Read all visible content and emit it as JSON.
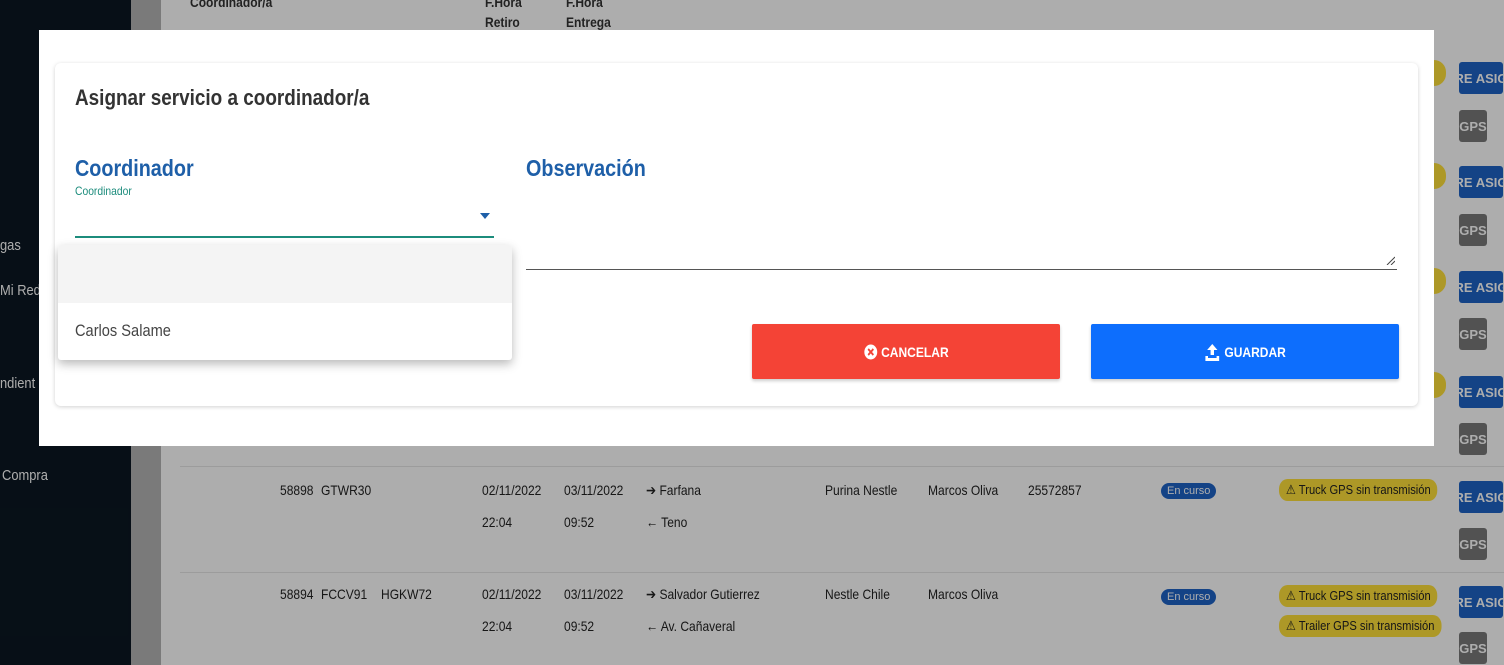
{
  "sidebar": {
    "items": [
      {
        "label": "gas"
      },
      {
        "label": "Mi Red"
      },
      {
        "label": "ndient"
      },
      {
        "label": "Compra"
      }
    ]
  },
  "table": {
    "headers": {
      "coordinador": "Coordinador/a",
      "retiro_1": "F.Hora",
      "retiro_2": "Retiro",
      "entrega_1": "F.Hora",
      "entrega_2": "Entrega"
    },
    "rows": [
      {
        "id": "58898",
        "tracto": "GTWR30",
        "rampla": "",
        "retiro_fecha": "02/11/2022",
        "retiro_hora": "22:04",
        "entrega_fecha": "03/11/2022",
        "entrega_hora": "09:52",
        "origen": "Farfana",
        "destino": "Teno",
        "cliente": "Purina Nestle",
        "transportista": "Marcos Oliva",
        "numero": "25572857",
        "estado": "En curso",
        "alertas": [
          "Truck GPS sin transmisión"
        ]
      },
      {
        "id": "58894",
        "tracto": "FCCV91",
        "rampla": "HGKW72",
        "retiro_fecha": "02/11/2022",
        "retiro_hora": "22:04",
        "entrega_fecha": "03/11/2022",
        "entrega_hora": "09:52",
        "origen": "Salvador Gutierrez",
        "destino": "Av. Cañaveral",
        "cliente": "Nestle Chile",
        "transportista": "Marcos Oliva",
        "numero": "",
        "estado": "En curso",
        "alertas": [
          "Truck GPS sin transmisión",
          "Trailer GPS sin transmisión"
        ]
      }
    ],
    "row_buttons": {
      "reasignar": "RE ASIG",
      "gps": "GPS"
    }
  },
  "modal": {
    "title": "Asignar servicio a coordinador/a",
    "coordinador": {
      "label": "Coordinador",
      "sublabel": "Coordinador",
      "value": ""
    },
    "observacion": {
      "label": "Observación",
      "value": ""
    },
    "buttons": {
      "cancel": "CANCELAR",
      "save": "GUARDAR"
    },
    "dropdown": {
      "options": [
        "",
        "Carlos Salame"
      ]
    }
  },
  "colors": {
    "cancel": "#f44336",
    "save": "#0d6efd",
    "label_blue": "#1e5fa8",
    "select_underline": "#1c8c7c"
  }
}
